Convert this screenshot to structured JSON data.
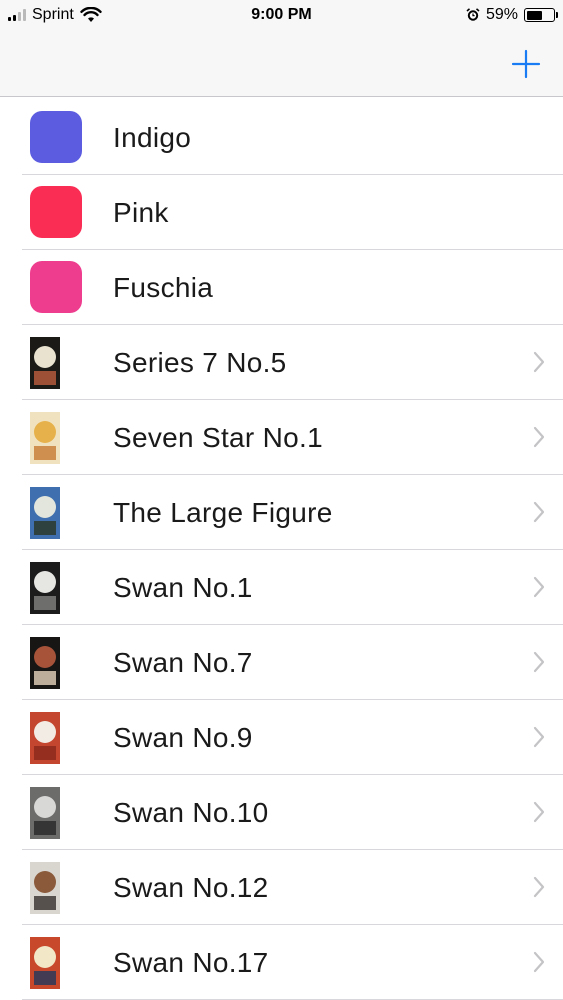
{
  "status_bar": {
    "carrier": "Sprint",
    "time": "9:00 PM",
    "battery_percent": "59%",
    "battery_level": 0.59,
    "signal_bars": 2
  },
  "nav_bar": {
    "add_icon": "plus-icon",
    "accent_color": "#1a7cf4"
  },
  "items": [
    {
      "label": "Indigo",
      "kind": "color",
      "color": "#5b5ce0"
    },
    {
      "label": "Pink",
      "kind": "color",
      "color": "#fa2d55"
    },
    {
      "label": "Fuschia",
      "kind": "color",
      "color": "#ee3d8e"
    },
    {
      "label": "Series 7 No.5",
      "kind": "artwork",
      "colors": [
        "#1b1a17",
        "#e8e2cf",
        "#b45b3c"
      ]
    },
    {
      "label": "Seven Star No.1",
      "kind": "artwork",
      "colors": [
        "#f1e2bf",
        "#e6b14a",
        "#c9803a"
      ]
    },
    {
      "label": "The Large Figure",
      "kind": "artwork",
      "colors": [
        "#3f6fae",
        "#e3e6dc",
        "#2d3a2a"
      ]
    },
    {
      "label": "Swan No.1",
      "kind": "artwork",
      "colors": [
        "#1c1c1c",
        "#e6e6e3",
        "#7d7d7a"
      ]
    },
    {
      "label": "Swan No.7",
      "kind": "artwork",
      "colors": [
        "#181614",
        "#a6533a",
        "#d9c9b3"
      ]
    },
    {
      "label": "Swan No.9",
      "kind": "artwork",
      "colors": [
        "#c4462e",
        "#f2ece4",
        "#8e2a1d"
      ]
    },
    {
      "label": "Swan No.10",
      "kind": "artwork",
      "colors": [
        "#6c6c6a",
        "#d8d8d6",
        "#2b2b2b"
      ]
    },
    {
      "label": "Swan No.12",
      "kind": "artwork",
      "colors": [
        "#d9d5cf",
        "#8a5a3a",
        "#3e3a36"
      ]
    },
    {
      "label": "Swan No.17",
      "kind": "artwork",
      "colors": [
        "#c8482c",
        "#f2e8c8",
        "#2c3a5a"
      ]
    }
  ]
}
